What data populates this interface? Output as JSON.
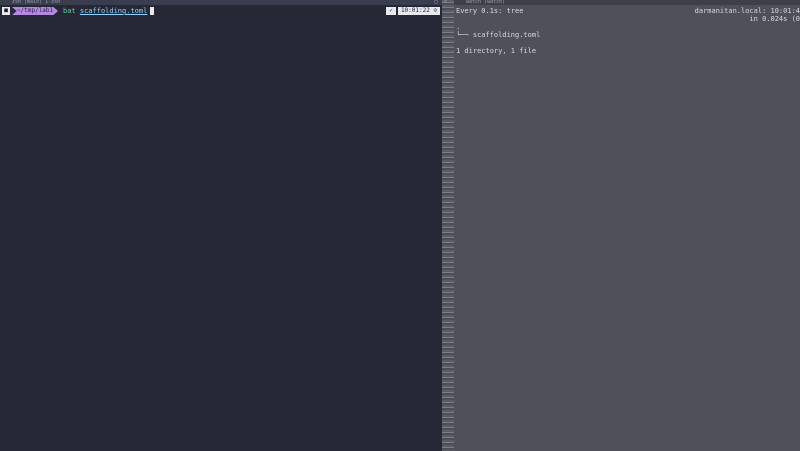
{
  "left_pane": {
    "title": "zsh (main) 1-zsh",
    "prompt": {
      "os_glyph": "■",
      "directory": "~/tmp/lab1",
      "command": "bat",
      "argument": "scaffolding.toml",
      "status_glyph": "✓",
      "clock": "10:01:22 ⊙"
    }
  },
  "right_pane": {
    "title": "watch (watch)",
    "header_left": "Every 0.1s: tree",
    "header_right_1": "darmanitan.local: 10:01:4",
    "header_right_2": "in 0.024s (0",
    "tree_root": ".",
    "tree_file": "└── scaffolding.toml",
    "summary": "1 directory, 1 file"
  }
}
